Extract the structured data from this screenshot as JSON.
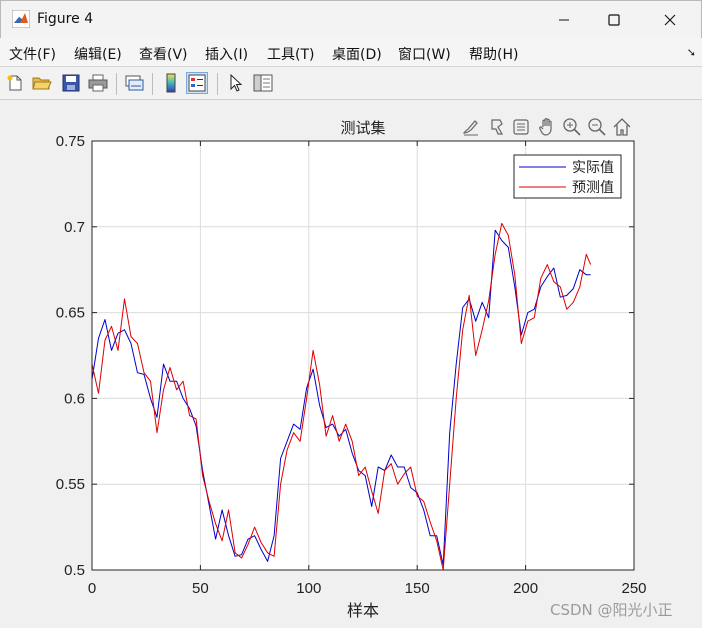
{
  "window": {
    "title": "Figure 4",
    "controls": [
      "minimize",
      "maximize",
      "close"
    ]
  },
  "menu": {
    "items": [
      "文件(F)",
      "编辑(E)",
      "查看(V)",
      "插入(I)",
      "工具(T)",
      "桌面(D)",
      "窗口(W)",
      "帮助(H)"
    ],
    "overflow_icon": "dock-arrow-icon"
  },
  "toolbar": {
    "buttons": [
      {
        "name": "new-figure-button",
        "icon": "new-file-icon"
      },
      {
        "name": "open-file-button",
        "icon": "folder-open-icon"
      },
      {
        "name": "save-button",
        "icon": "save-icon"
      },
      {
        "name": "print-button",
        "icon": "printer-icon"
      },
      {
        "name": "link-plot-button",
        "icon": "link-plot-icon"
      },
      {
        "name": "insert-colorbar-button",
        "icon": "colorbar-icon"
      },
      {
        "name": "insert-legend-button",
        "icon": "legend-icon",
        "pressed": true
      },
      {
        "name": "edit-plot-button",
        "icon": "cursor-arrow-icon"
      },
      {
        "name": "property-inspector-button",
        "icon": "panel-icon"
      }
    ]
  },
  "axes_toolbar": {
    "icons": [
      "brush-icon",
      "data-tips-icon",
      "restore-view-icon",
      "pan-hand-icon",
      "zoom-in-icon",
      "zoom-out-icon",
      "home-icon"
    ]
  },
  "watermark": "CSDN @阳光小正",
  "colors": {
    "actual": "#0000cc",
    "predicted": "#dd0000",
    "grid": "#dcdcdc",
    "axes_bg": "#ffffff"
  },
  "chart_data": {
    "type": "line",
    "title": "测试集",
    "xlabel": "样本",
    "ylabel": "",
    "xlim": [
      0,
      250
    ],
    "ylim": [
      0.5,
      0.75
    ],
    "xticks": [
      0,
      50,
      100,
      150,
      200,
      250
    ],
    "yticks": [
      0.5,
      0.55,
      0.6,
      0.65,
      0.7,
      0.75
    ],
    "grid": true,
    "legend_position": "top-right",
    "series": [
      {
        "name": "实际值",
        "color": "#0000cc",
        "x": [
          0,
          3,
          6,
          9,
          12,
          15,
          18,
          21,
          24,
          27,
          30,
          33,
          36,
          39,
          42,
          45,
          48,
          51,
          54,
          57,
          60,
          63,
          66,
          69,
          72,
          75,
          78,
          81,
          84,
          87,
          90,
          93,
          96,
          99,
          102,
          105,
          108,
          111,
          114,
          117,
          120,
          123,
          126,
          129,
          132,
          135,
          138,
          141,
          144,
          147,
          150,
          153,
          156,
          159,
          162,
          165,
          168,
          171,
          174,
          177,
          180,
          183,
          186,
          189,
          192,
          195,
          198,
          201,
          204,
          207,
          210,
          213,
          216,
          219,
          222,
          225,
          228,
          230
        ],
        "values": [
          0.611,
          0.635,
          0.646,
          0.628,
          0.638,
          0.64,
          0.632,
          0.615,
          0.614,
          0.6,
          0.589,
          0.62,
          0.61,
          0.61,
          0.6,
          0.594,
          0.584,
          0.558,
          0.538,
          0.518,
          0.535,
          0.52,
          0.508,
          0.509,
          0.518,
          0.52,
          0.512,
          0.505,
          0.52,
          0.565,
          0.575,
          0.585,
          0.582,
          0.606,
          0.617,
          0.596,
          0.583,
          0.585,
          0.578,
          0.582,
          0.568,
          0.558,
          0.555,
          0.537,
          0.56,
          0.558,
          0.567,
          0.56,
          0.56,
          0.548,
          0.545,
          0.535,
          0.52,
          0.52,
          0.503,
          0.58,
          0.62,
          0.653,
          0.658,
          0.645,
          0.656,
          0.647,
          0.698,
          0.692,
          0.688,
          0.665,
          0.637,
          0.65,
          0.652,
          0.665,
          0.671,
          0.676,
          0.659,
          0.66,
          0.664,
          0.675,
          0.672,
          0.672
        ]
      },
      {
        "name": "预测值",
        "color": "#dd0000",
        "x": [
          0,
          3,
          6,
          9,
          12,
          15,
          18,
          21,
          24,
          27,
          30,
          33,
          36,
          39,
          42,
          45,
          48,
          51,
          54,
          57,
          60,
          63,
          66,
          69,
          72,
          75,
          78,
          81,
          84,
          87,
          90,
          93,
          96,
          99,
          102,
          105,
          108,
          111,
          114,
          117,
          120,
          123,
          126,
          129,
          132,
          135,
          138,
          141,
          144,
          147,
          150,
          153,
          156,
          159,
          162,
          165,
          168,
          171,
          174,
          177,
          180,
          183,
          186,
          189,
          192,
          195,
          198,
          201,
          204,
          207,
          210,
          213,
          216,
          219,
          222,
          225,
          228,
          230
        ],
        "values": [
          0.62,
          0.603,
          0.634,
          0.642,
          0.628,
          0.658,
          0.636,
          0.632,
          0.615,
          0.61,
          0.58,
          0.605,
          0.618,
          0.605,
          0.61,
          0.59,
          0.588,
          0.555,
          0.54,
          0.527,
          0.517,
          0.535,
          0.51,
          0.507,
          0.515,
          0.525,
          0.516,
          0.51,
          0.508,
          0.55,
          0.57,
          0.58,
          0.575,
          0.6,
          0.628,
          0.608,
          0.578,
          0.59,
          0.575,
          0.585,
          0.575,
          0.555,
          0.56,
          0.546,
          0.533,
          0.558,
          0.562,
          0.55,
          0.556,
          0.56,
          0.543,
          0.54,
          0.528,
          0.517,
          0.5,
          0.55,
          0.6,
          0.64,
          0.66,
          0.625,
          0.64,
          0.657,
          0.684,
          0.702,
          0.695,
          0.672,
          0.632,
          0.645,
          0.647,
          0.67,
          0.678,
          0.668,
          0.665,
          0.652,
          0.656,
          0.665,
          0.684,
          0.678
        ]
      }
    ]
  }
}
